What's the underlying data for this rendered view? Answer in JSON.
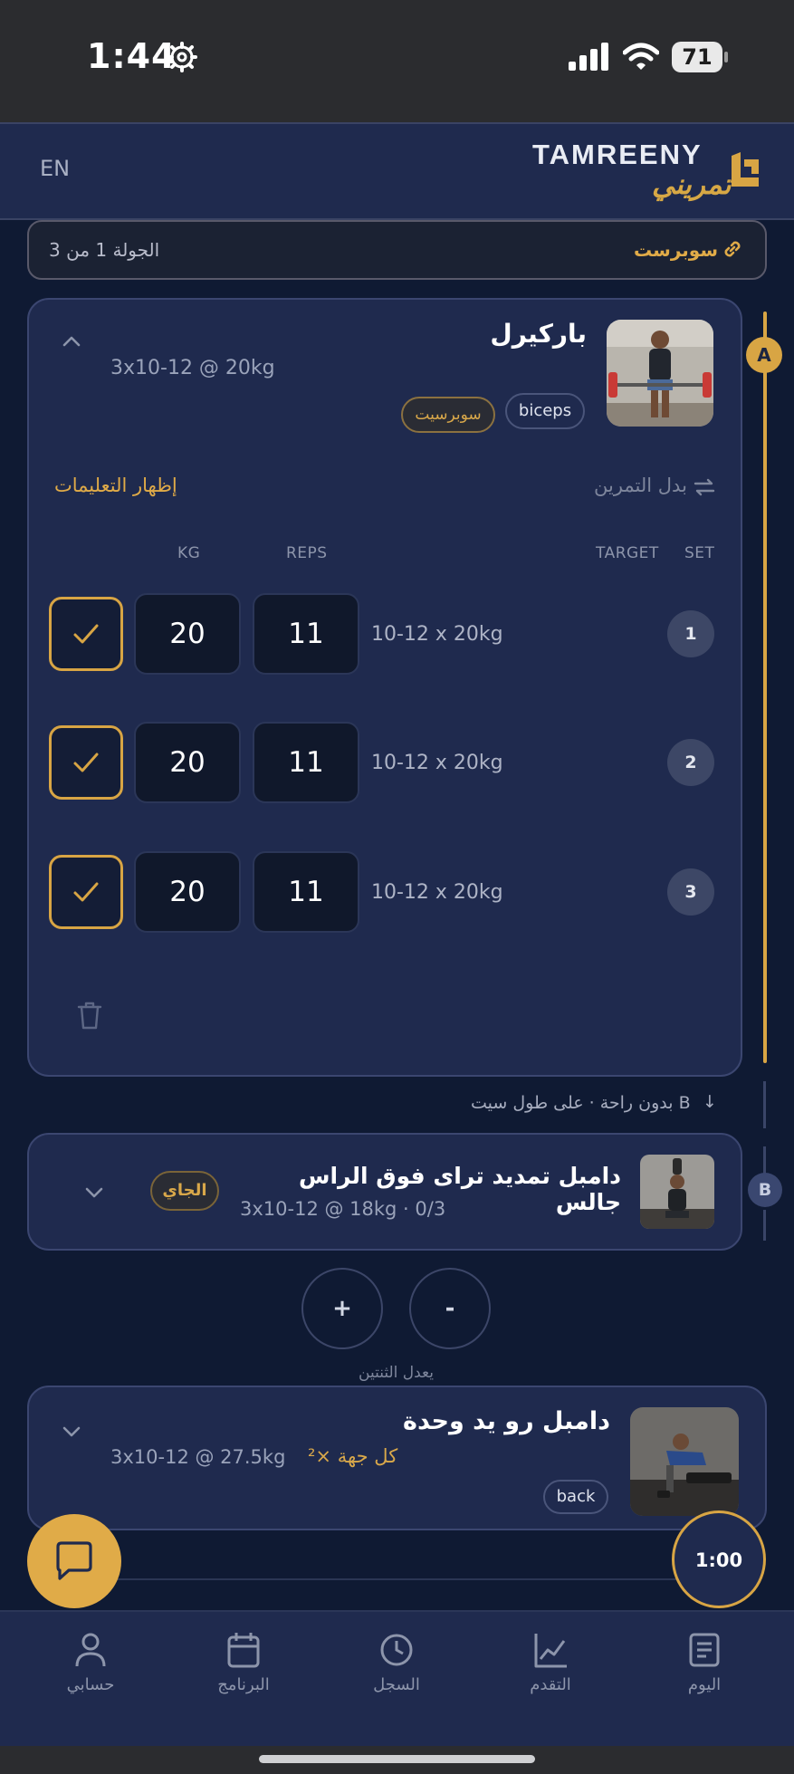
{
  "status_bar": {
    "time": "1:44",
    "battery": "71"
  },
  "header": {
    "lang_toggle": "EN",
    "brand_en": "TAMREENY",
    "brand_ar": "تمريني"
  },
  "superset_bar": {
    "label": "سوبرست",
    "round": "الجولة 1 من 3"
  },
  "rail": {
    "badge_a": "A",
    "badge_b": "B"
  },
  "exercise_a": {
    "title": "باركيرل",
    "scheme": "3x10-12 @ 20kg",
    "tags": [
      "biceps",
      "سوبرسيت"
    ],
    "show_instructions": "إظهار التعليمات",
    "swap": "بدل التمرين",
    "columns": {
      "kg": "KG",
      "reps": "REPS",
      "target": "TARGET",
      "set": "SET"
    },
    "sets": [
      {
        "set": "1",
        "target": "10-12 x 20kg",
        "reps": "11",
        "kg": "20"
      },
      {
        "set": "2",
        "target": "10-12 x 20kg",
        "reps": "11",
        "kg": "20"
      },
      {
        "set": "3",
        "target": "10-12 x 20kg",
        "reps": "11",
        "kg": "20"
      }
    ]
  },
  "rest_note": {
    "text": "بدون راحة · على طول سيت B",
    "arrow": "↓"
  },
  "exercise_b": {
    "title": "دامبل تمديد ترای فوق الراس جالس",
    "sub": "3x10-12 @ 18kg · 0/3",
    "next": "الجاي"
  },
  "stepper": {
    "plus": "+",
    "minus": "-",
    "label": "يعدل الثنتين"
  },
  "exercise_c": {
    "title": "دامبل رو يد وحدة",
    "each_side": "كل جهة ×²",
    "scheme": "3x10-12 @ 27.5kg",
    "tag": "back"
  },
  "timer": {
    "label": "1:00"
  },
  "tabs": [
    {
      "label": "حسابي",
      "icon": "user-icon"
    },
    {
      "label": "البرنامج",
      "icon": "calendar-icon"
    },
    {
      "label": "السجل",
      "icon": "clock-icon"
    },
    {
      "label": "التقدم",
      "icon": "chart-icon"
    },
    {
      "label": "اليوم",
      "icon": "list-icon"
    }
  ],
  "colors": {
    "accent": "#d8a544",
    "background": "#0f1a33",
    "card": "#1f2a4e"
  }
}
